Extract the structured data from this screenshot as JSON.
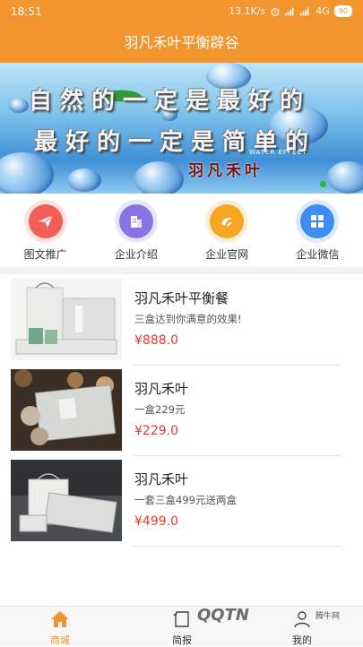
{
  "statusbar": {
    "time": "18:51",
    "speed": "13.1K/s",
    "network": "4G",
    "battery": "90"
  },
  "header": {
    "title": "羽凡禾叶平衡辟谷"
  },
  "banner": {
    "line1": "自然的一定是最好的",
    "line2": "最好的一定是简单的",
    "brand": "羽凡禾叶",
    "effect": "WATER EFFECT"
  },
  "quick_menu": [
    {
      "label": "图文推广",
      "icon": "paper-plane-icon",
      "color": "#f25d55"
    },
    {
      "label": "企业介绍",
      "icon": "building-icon",
      "color": "#8a72e6"
    },
    {
      "label": "企业官网",
      "icon": "globe-icon",
      "color": "#f6a623"
    },
    {
      "label": "企业微信",
      "icon": "grid-icon",
      "color": "#3d8ef0"
    }
  ],
  "products": [
    {
      "name": "羽凡禾叶平衡餐",
      "desc": "三盒达到你满意的效果!",
      "price": "¥888.0"
    },
    {
      "name": "羽凡禾叶",
      "desc": "一盒229元",
      "price": "¥229.0"
    },
    {
      "name": "羽凡禾叶",
      "desc": "一套三盒499元送两盒",
      "price": "¥499.0"
    }
  ],
  "bottom_nav": [
    {
      "label": "商城",
      "icon": "home-icon",
      "active": true
    },
    {
      "label": "简报",
      "icon": "newspaper-icon",
      "active": false
    },
    {
      "label": "我的",
      "icon": "user-icon",
      "active": false
    }
  ],
  "watermark": {
    "logo": "QQTN",
    "site": "腾牛网"
  },
  "colors": {
    "primary": "#f2952f",
    "price": "#e43c2f"
  }
}
